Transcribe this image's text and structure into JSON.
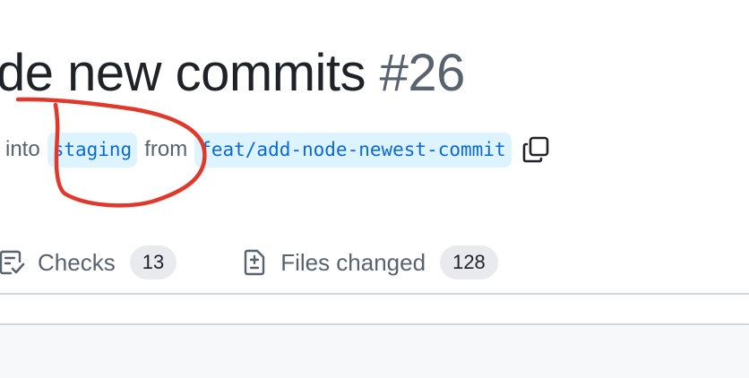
{
  "pull_request": {
    "title_visible": "de new commits",
    "number": "#26",
    "meta": {
      "into_word": "into",
      "base_branch": "staging",
      "from_word": "from",
      "head_branch": "feat/add-node-newest-commit"
    }
  },
  "tabs": [
    {
      "label": "Checks",
      "count": "13",
      "icon": "checklist-icon"
    },
    {
      "label": "Files changed",
      "count": "128",
      "icon": "file-diff-icon"
    }
  ],
  "annotation": {
    "color": "#e0392b",
    "shape": "freehand-circle-around-base-branch"
  },
  "colors": {
    "branch_text": "#0969da",
    "branch_bg": "#ddf4ff",
    "muted_text": "#59636e",
    "counter_bg": "#e8eaed",
    "panel_bg": "#f6f8fa"
  }
}
